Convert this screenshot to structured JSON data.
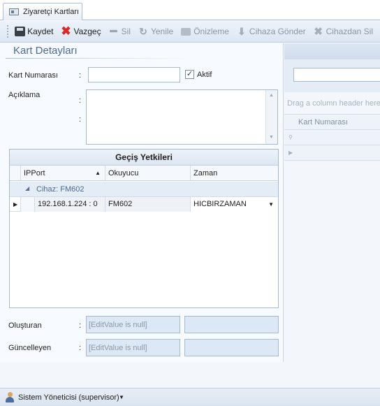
{
  "tab": {
    "label": "Ziyaretçi Kartları",
    "icon": "id-card-icon"
  },
  "toolbar": {
    "items": [
      {
        "label": "Kaydet",
        "icon": "save-icon",
        "enabled": true
      },
      {
        "label": "Vazgeç",
        "icon": "cancel-icon",
        "enabled": true
      },
      {
        "label": "Sil",
        "icon": "minus-icon",
        "enabled": false
      },
      {
        "label": "Yenile",
        "icon": "refresh-icon",
        "enabled": false
      },
      {
        "label": "Önizleme",
        "icon": "print-icon",
        "enabled": false
      },
      {
        "label": "Cihaza Gönder",
        "icon": "download-icon",
        "enabled": false
      },
      {
        "label": "Cihazdan Sil",
        "icon": "delete-icon",
        "enabled": false
      }
    ]
  },
  "details": {
    "title": "Kart Detayları",
    "card_number_label": "Kart Numarası",
    "card_number_value": "",
    "colon": ":",
    "active_label": "Aktif",
    "active_checked": true,
    "active_mark": "✓",
    "description_label": "Açıklama",
    "description_value": ""
  },
  "permissions": {
    "title": "Geçiş Yetkileri",
    "columns": [
      "IPPort",
      "Okuyucu",
      "Zaman"
    ],
    "group_label": "Cihaz: FM602",
    "rows": [
      {
        "ipport": "192.168.1.224 : 0",
        "reader": "FM602",
        "time": "HICBIRZAMAN"
      }
    ]
  },
  "audit": {
    "created_label": "Oluşturan",
    "created_value": "[EditValue is null]",
    "updated_label": "Güncelleyen",
    "updated_value": "[EditValue is null]"
  },
  "side_grid": {
    "drag_hint": "Drag a column header here",
    "column": "Kart Numarası",
    "filter_icon": "pin-icon"
  },
  "status": {
    "user": "Sistem Yöneticisi (supervisor)"
  }
}
